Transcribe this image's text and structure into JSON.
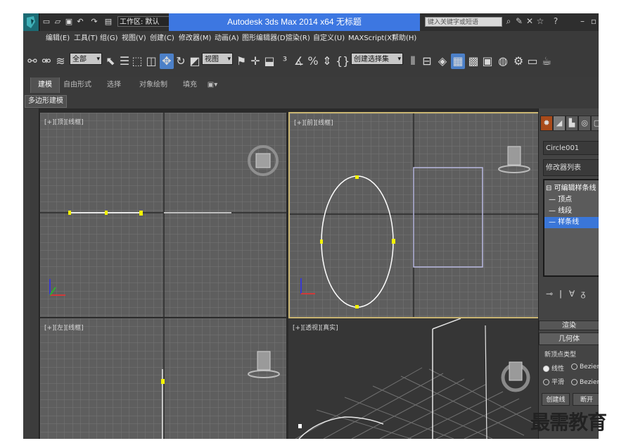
{
  "title_bar": {
    "workspace": "工作区: 默认",
    "title": "Autodesk 3ds Max  2014 x64      无标题",
    "search_placeholder": "键入关键字或短语"
  },
  "menu": {
    "items": [
      "编辑(E)",
      "工具(T)",
      "组(G)",
      "视图(V)",
      "创建(C)",
      "修改器(M)",
      "动画(A)",
      "图形编辑器(D)",
      "渲染(R)",
      "自定义(U)",
      "MAXScript(X)",
      "帮助(H)"
    ]
  },
  "toolbar": {
    "selection_filter": "全部",
    "reference_coord": "视图",
    "named_selection": "创建选择集"
  },
  "ribbon": {
    "tabs": [
      "建模",
      "自由形式",
      "选择",
      "对象绘制",
      "填充"
    ],
    "active_tab": "建模",
    "sub_tab": "多边形建模"
  },
  "viewports": {
    "top_label": "[+][顶][线框]",
    "front_label": "[+][前][线框]",
    "left_label": "[+][左][线框]",
    "persp_label": "[+][透视][真实]"
  },
  "command_panel": {
    "object_name": "Circle001",
    "modifier_list": "修改器列表",
    "stack_root": "可编辑样条线",
    "stack_items": [
      "顶点",
      "线段",
      "样条线"
    ],
    "selected_item": "样条线",
    "rollout_top": "渲染",
    "rollout_geometry": "几何体",
    "new_vertex_type": "新顶点类型",
    "radio_linear": "线性",
    "radio_bezier": "Bezier",
    "radio_smooth": "平滑",
    "radio_bezier_corner": "Bezier 角点",
    "create_line": "创建线",
    "break": "断开"
  },
  "watermark": "最需教育",
  "colors": {
    "title_highlight": "#3d77e1",
    "active_viewport_border": "#c8b472",
    "spline": "#ffffff",
    "vertex": "#ffff00",
    "rect_shape": "#b8b8e0",
    "selection_blue": "#3a76d8"
  }
}
